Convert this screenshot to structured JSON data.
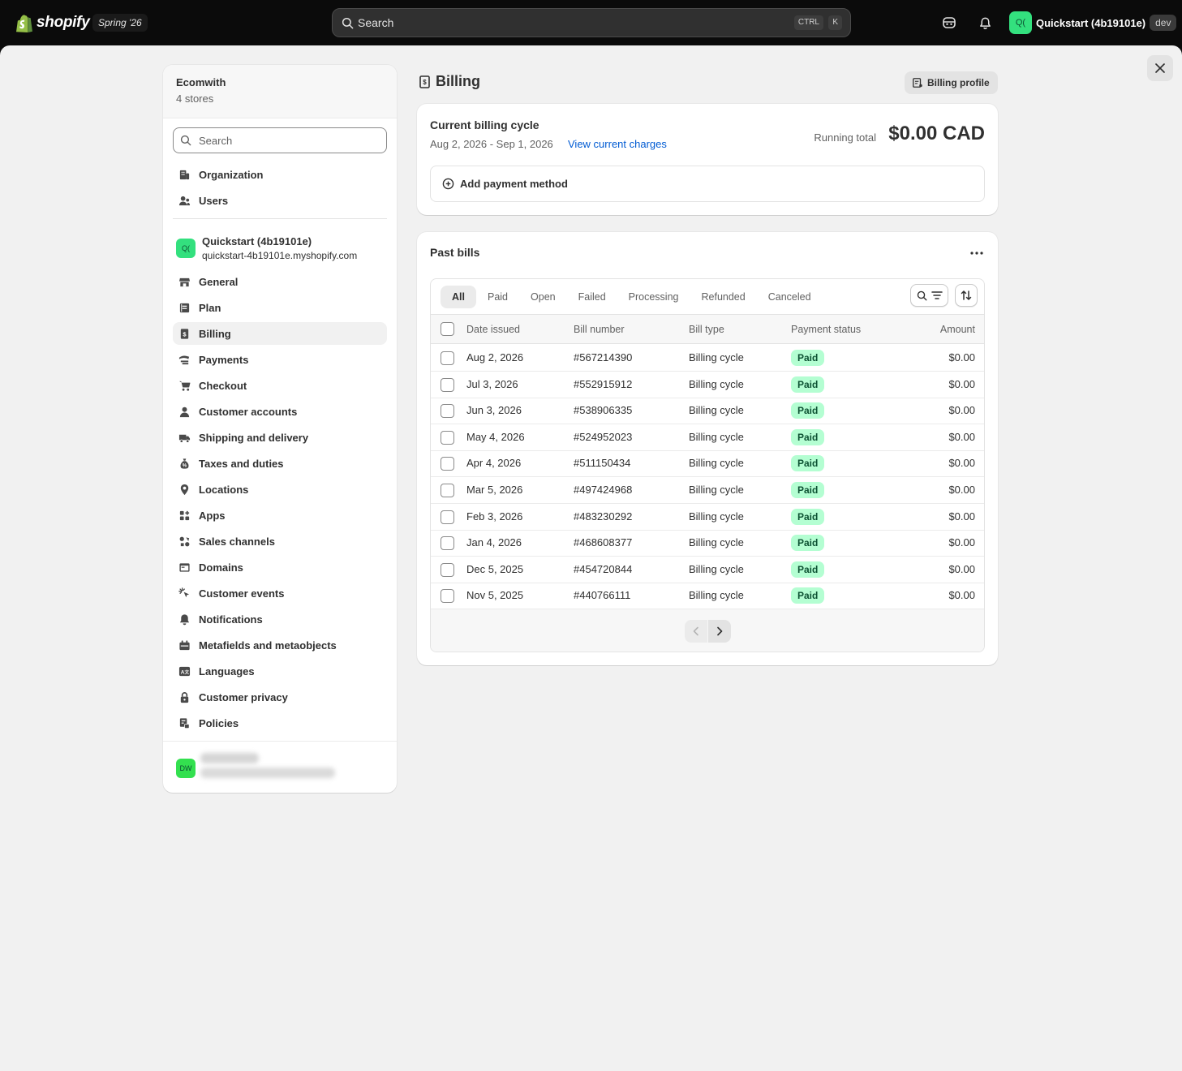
{
  "topbar": {
    "brand": "shopify",
    "edition": "Spring '26",
    "search_placeholder": "Search",
    "kbd_ctrl": "CTRL",
    "kbd_k": "K",
    "store_avatar": "Q(",
    "store_name": "Quickstart (4b19101e)",
    "store_tag": "dev"
  },
  "sidebar": {
    "org_name": "Ecomwith",
    "org_stores": "4 stores",
    "search_placeholder": "Search",
    "org_items": [
      {
        "label": "Organization",
        "icon": "organization-icon"
      },
      {
        "label": "Users",
        "icon": "users-icon"
      }
    ],
    "store": {
      "avatar": "Q(",
      "name": "Quickstart (4b19101e)",
      "url": "quickstart-4b19101e.myshopify.com"
    },
    "items": [
      {
        "label": "General",
        "icon": "store-icon"
      },
      {
        "label": "Plan",
        "icon": "plan-icon"
      },
      {
        "label": "Billing",
        "icon": "receipt-icon"
      },
      {
        "label": "Payments",
        "icon": "payments-icon"
      },
      {
        "label": "Checkout",
        "icon": "cart-icon"
      },
      {
        "label": "Customer accounts",
        "icon": "person-icon"
      },
      {
        "label": "Shipping and delivery",
        "icon": "truck-icon"
      },
      {
        "label": "Taxes and duties",
        "icon": "money-bag-icon"
      },
      {
        "label": "Locations",
        "icon": "location-pin-icon"
      },
      {
        "label": "Apps",
        "icon": "apps-icon"
      },
      {
        "label": "Sales channels",
        "icon": "sales-channels-icon"
      },
      {
        "label": "Domains",
        "icon": "domains-icon"
      },
      {
        "label": "Customer events",
        "icon": "cursor-click-icon"
      },
      {
        "label": "Notifications",
        "icon": "bell-icon"
      },
      {
        "label": "Metafields and metaobjects",
        "icon": "metafields-icon"
      },
      {
        "label": "Languages",
        "icon": "language-icon"
      },
      {
        "label": "Customer privacy",
        "icon": "lock-icon"
      },
      {
        "label": "Policies",
        "icon": "policies-icon"
      }
    ],
    "user_avatar": "DW"
  },
  "billing": {
    "title": "Billing",
    "profile_button": "Billing profile",
    "cycle_title": "Current billing cycle",
    "cycle_dates": "Aug 2, 2026 - Sep 1, 2026",
    "view_charges": "View current charges",
    "running_total_label": "Running total",
    "running_total": "$0.00 CAD",
    "add_payment": "Add payment method"
  },
  "past_bills": {
    "title": "Past bills",
    "tabs": [
      "All",
      "Paid",
      "Open",
      "Failed",
      "Processing",
      "Refunded",
      "Canceled"
    ],
    "columns": [
      "Date issued",
      "Bill number",
      "Bill type",
      "Payment status",
      "Amount"
    ],
    "rows": [
      {
        "date": "Aug 2, 2026",
        "number": "#567214390",
        "type": "Billing cycle",
        "status": "Paid",
        "amount": "$0.00"
      },
      {
        "date": "Jul 3, 2026",
        "number": "#552915912",
        "type": "Billing cycle",
        "status": "Paid",
        "amount": "$0.00"
      },
      {
        "date": "Jun 3, 2026",
        "number": "#538906335",
        "type": "Billing cycle",
        "status": "Paid",
        "amount": "$0.00"
      },
      {
        "date": "May 4, 2026",
        "number": "#524952023",
        "type": "Billing cycle",
        "status": "Paid",
        "amount": "$0.00"
      },
      {
        "date": "Apr 4, 2026",
        "number": "#511150434",
        "type": "Billing cycle",
        "status": "Paid",
        "amount": "$0.00"
      },
      {
        "date": "Mar 5, 2026",
        "number": "#497424968",
        "type": "Billing cycle",
        "status": "Paid",
        "amount": "$0.00"
      },
      {
        "date": "Feb 3, 2026",
        "number": "#483230292",
        "type": "Billing cycle",
        "status": "Paid",
        "amount": "$0.00"
      },
      {
        "date": "Jan 4, 2026",
        "number": "#468608377",
        "type": "Billing cycle",
        "status": "Paid",
        "amount": "$0.00"
      },
      {
        "date": "Dec 5, 2025",
        "number": "#454720844",
        "type": "Billing cycle",
        "status": "Paid",
        "amount": "$0.00"
      },
      {
        "date": "Nov 5, 2025",
        "number": "#440766111",
        "type": "Billing cycle",
        "status": "Paid",
        "amount": "$0.00"
      }
    ]
  },
  "colors": {
    "topbar_bg": "#0b0b0b",
    "panel_bg": "#f1f1f1",
    "link": "#005bd3",
    "paid_badge_bg": "#b4fed2",
    "paid_badge_text": "#0c5132",
    "store_avatar": "#33e07e"
  }
}
